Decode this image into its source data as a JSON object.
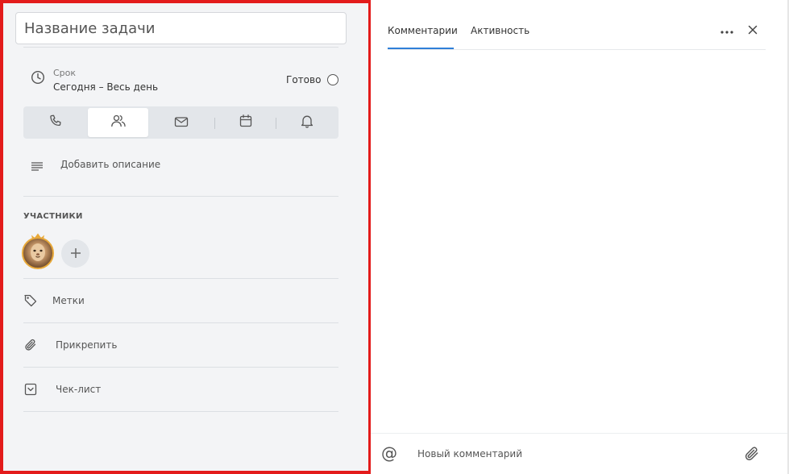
{
  "task": {
    "title_placeholder": "Название задачи",
    "title_value": ""
  },
  "deadline": {
    "label": "Срок",
    "value": "Сегодня – Весь день",
    "icon": "clock-icon"
  },
  "done": {
    "label": "Готово",
    "checked": false
  },
  "task_types": [
    {
      "name": "call",
      "icon": "phone-icon",
      "active": false
    },
    {
      "name": "meeting",
      "icon": "people-icon",
      "active": true
    },
    {
      "name": "email",
      "icon": "mail-icon",
      "active": false
    },
    {
      "name": "event",
      "icon": "calendar-icon",
      "active": false
    },
    {
      "name": "reminder",
      "icon": "bell-icon",
      "active": false
    }
  ],
  "description": {
    "label": "Добавить описание",
    "icon": "text-lines-icon"
  },
  "participants": {
    "title": "УЧАСТНИКИ",
    "owner_badge": "crown-icon",
    "add_icon": "plus-icon"
  },
  "actions": {
    "tags": {
      "label": "Метки",
      "icon": "tag-icon"
    },
    "attach": {
      "label": "Прикрепить",
      "icon": "paperclip-icon"
    },
    "checklist": {
      "label": "Чек-лист",
      "icon": "checkbox-chevron-icon"
    }
  },
  "right_panel": {
    "tabs": [
      {
        "label": "Комментарии",
        "active": true
      },
      {
        "label": "Активность",
        "active": false
      }
    ],
    "more_icon": "more-dots-icon",
    "close_icon": "close-icon",
    "mention_symbol": "@",
    "comment_placeholder": "Новый комментарий",
    "attach_icon": "paperclip-icon"
  },
  "colors": {
    "highlight_border": "#e31b1b",
    "accent": "#2f7fd8",
    "left_bg": "#f3f4f6",
    "owner_crown": "#e8a93a"
  }
}
